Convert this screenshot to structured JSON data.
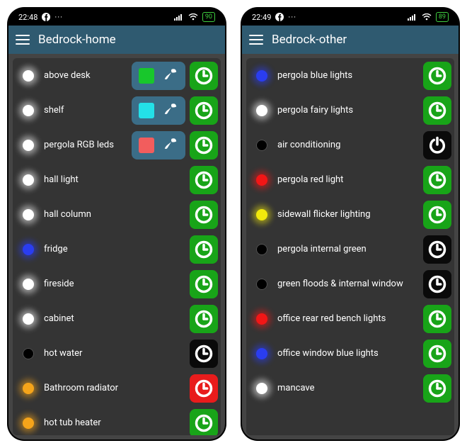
{
  "colors": {
    "accent_green": "#18a418",
    "accent_black": "#0a0a0a",
    "accent_red": "#e81c1c",
    "appbar_bg": "#2f5a70",
    "panel_bg": "#343434",
    "pill_bg": "#3b6d87"
  },
  "phones": [
    {
      "status": {
        "time": "22:48",
        "battery": "90"
      },
      "title": "Bedrock-home",
      "rows": [
        {
          "label": "above desk",
          "dot": "white",
          "glow": true,
          "right": {
            "type": "rgb",
            "swatch": "#18c72c"
          }
        },
        {
          "label": "shelf",
          "dot": "white",
          "glow": true,
          "right": {
            "type": "rgb",
            "swatch": "#23e0e8"
          }
        },
        {
          "label": "pergola RGB leds",
          "dot": "white",
          "glow": true,
          "right": {
            "type": "rgb",
            "swatch": "#f25d5d"
          }
        },
        {
          "label": "hall light",
          "dot": "white",
          "glow": true,
          "right": {
            "type": "clock",
            "bg": "accent_green"
          }
        },
        {
          "label": "hall column",
          "dot": "white",
          "glow": true,
          "right": {
            "type": "clock",
            "bg": "accent_green"
          }
        },
        {
          "label": "fridge",
          "dot": "#2a3df0",
          "glow": true,
          "right": {
            "type": "clock",
            "bg": "accent_green"
          }
        },
        {
          "label": "fireside",
          "dot": "white",
          "glow": true,
          "right": {
            "type": "clock",
            "bg": "accent_green"
          }
        },
        {
          "label": "cabinet",
          "dot": "white",
          "glow": true,
          "right": {
            "type": "clock",
            "bg": "accent_green"
          }
        },
        {
          "label": "hot water",
          "dot": "black",
          "glow": false,
          "right": {
            "type": "clock",
            "bg": "accent_black"
          }
        },
        {
          "label": "Bathroom radiator",
          "dot": "#f5a41a",
          "glow": true,
          "right": {
            "type": "clock",
            "bg": "accent_red"
          }
        },
        {
          "label": "hot tub heater",
          "dot": "#f5a41a",
          "glow": true,
          "right": {
            "type": "clock",
            "bg": "accent_green"
          }
        }
      ]
    },
    {
      "status": {
        "time": "22:49",
        "battery": "89"
      },
      "title": "Bedrock-other",
      "rows": [
        {
          "label": "pergola blue lights",
          "dot": "#2a3df0",
          "glow": true,
          "right": {
            "type": "clock",
            "bg": "accent_green"
          }
        },
        {
          "label": "pergola fairy lights",
          "dot": "white",
          "glow": true,
          "right": {
            "type": "clock",
            "bg": "accent_green"
          }
        },
        {
          "label": "air conditioning",
          "dot": "black",
          "glow": false,
          "right": {
            "type": "power",
            "bg": "accent_black"
          }
        },
        {
          "label": "pergola red light",
          "dot": "#f21616",
          "glow": true,
          "right": {
            "type": "clock",
            "bg": "accent_green"
          }
        },
        {
          "label": "sidewall flicker lighting",
          "dot": "#f2e90c",
          "glow": true,
          "right": {
            "type": "clock",
            "bg": "accent_green"
          }
        },
        {
          "label": "pergola internal green",
          "dot": "black",
          "glow": false,
          "right": {
            "type": "clock",
            "bg": "accent_black"
          }
        },
        {
          "label": "green floods & internal window",
          "dot": "black",
          "glow": false,
          "right": {
            "type": "clock",
            "bg": "accent_black"
          }
        },
        {
          "label": "office rear red bench lights",
          "dot": "#f21616",
          "glow": true,
          "right": {
            "type": "clock",
            "bg": "accent_green"
          }
        },
        {
          "label": "office window blue lights",
          "dot": "#2a3df0",
          "glow": true,
          "right": {
            "type": "clock",
            "bg": "accent_green"
          }
        },
        {
          "label": "mancave",
          "dot": "white",
          "glow": true,
          "right": {
            "type": "clock",
            "bg": "accent_green"
          }
        }
      ]
    }
  ]
}
